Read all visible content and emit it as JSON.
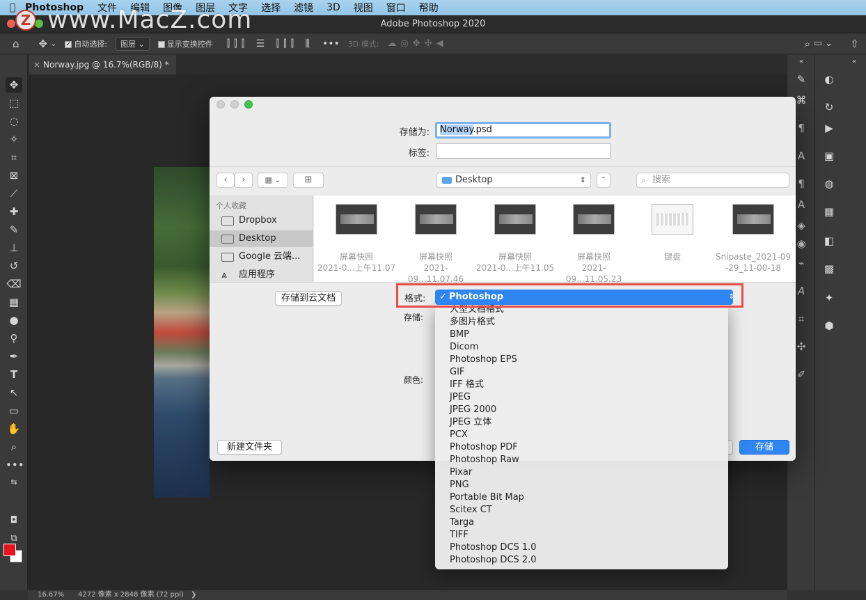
{
  "menubar": {
    "app_name": "Photoshop",
    "items": [
      "文件",
      "编辑",
      "图像",
      "图层",
      "文字",
      "选择",
      "滤镜",
      "3D",
      "视图",
      "窗口",
      "帮助"
    ]
  },
  "watermark": {
    "logo": "Z",
    "text": "www.MacZ.com"
  },
  "window": {
    "title": "Adobe Photoshop 2020"
  },
  "options_bar": {
    "auto_select_label": "自动选择:",
    "auto_select_value": "图层",
    "show_transform_label": "显示变换控件",
    "mode_3d_label": "3D 模式:"
  },
  "document_tab": {
    "label": "Norway.jpg @ 16.7%(RGB/8) *"
  },
  "status_bar": {
    "zoom": "16.67%",
    "dimensions": "4272 像素 x 2848 像素 (72 ppi)",
    "arrow": "❯"
  },
  "dialog": {
    "save_as_label": "存储为:",
    "filename_highlight": "Norway",
    "filename_rest": ".psd",
    "tags_label": "标签:",
    "tags_value": "",
    "location": "Desktop",
    "search_placeholder": "搜索",
    "sidebar": {
      "heading": "个人收藏",
      "items": [
        "Dropbox",
        "Desktop",
        "Google 云端...",
        "应用程序"
      ]
    },
    "files": [
      {
        "name1": "屏幕快照",
        "name2": "2021-0...上午11.07"
      },
      {
        "name1": "屏幕快照",
        "name2": "2021-09...11.07.46"
      },
      {
        "name1": "屏幕快照",
        "name2": "2021-0...上午11.05"
      },
      {
        "name1": "屏幕快照",
        "name2": "2021-09...11.05.23"
      },
      {
        "name1": "键盘",
        "name2": ""
      },
      {
        "name1": "Snipaste_2021-09",
        "name2": "-29_11-00-18"
      }
    ],
    "save_to_cloud": "存储到云文档",
    "format_label": "格式:",
    "format_selected": "Photoshop",
    "store_label": "存储:",
    "color_label": "颜色:",
    "new_folder": "新建文件夹",
    "save_button": "存储",
    "format_options": [
      "大型文档格式",
      "多图片格式",
      "BMP",
      "Dicom",
      "Photoshop EPS",
      "GIF",
      "IFF 格式",
      "JPEG",
      "JPEG 2000",
      "JPEG 立体",
      "PCX",
      "Photoshop PDF",
      "Photoshop Raw",
      "Pixar",
      "PNG",
      "Portable Bit Map",
      "Scitex CT",
      "Targa",
      "TIFF",
      "Photoshop DCS 1.0",
      "Photoshop DCS 2.0"
    ]
  }
}
